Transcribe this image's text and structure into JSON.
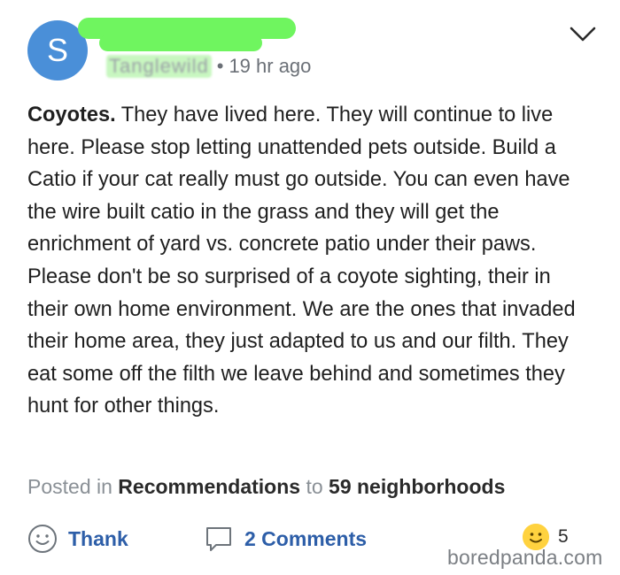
{
  "post": {
    "avatar_letter": "S",
    "location_redacted": "Tanglewild",
    "time_ago": "19 hr ago",
    "lead": "Coyotes.",
    "text": " They have lived here. They will continue to live here. Please stop letting unattended pets outside. Build a Catio if your cat really must go outside. You can even have the wire built catio in the grass and they will get the enrichment of yard vs. concrete patio under their paws. Please don't be so surprised of a coyote sighting, their in their own home environment. We are the ones that invaded their home area, they just adapted to us and our filth. They eat some off the filth we leave behind and sometimes they hunt for other things."
  },
  "footer": {
    "posted_in_label": "Posted in",
    "category": "Recommendations",
    "to_label": "to",
    "audience": "59 neighborhoods"
  },
  "actions": {
    "thank_label": "Thank",
    "comments_label": "2 Comments",
    "reaction_count": "5"
  },
  "watermark": "boredpanda.com",
  "colors": {
    "avatar": "#4a8fd8",
    "action_blue": "#2d5ea8",
    "redaction_green": "#6ff55f"
  }
}
